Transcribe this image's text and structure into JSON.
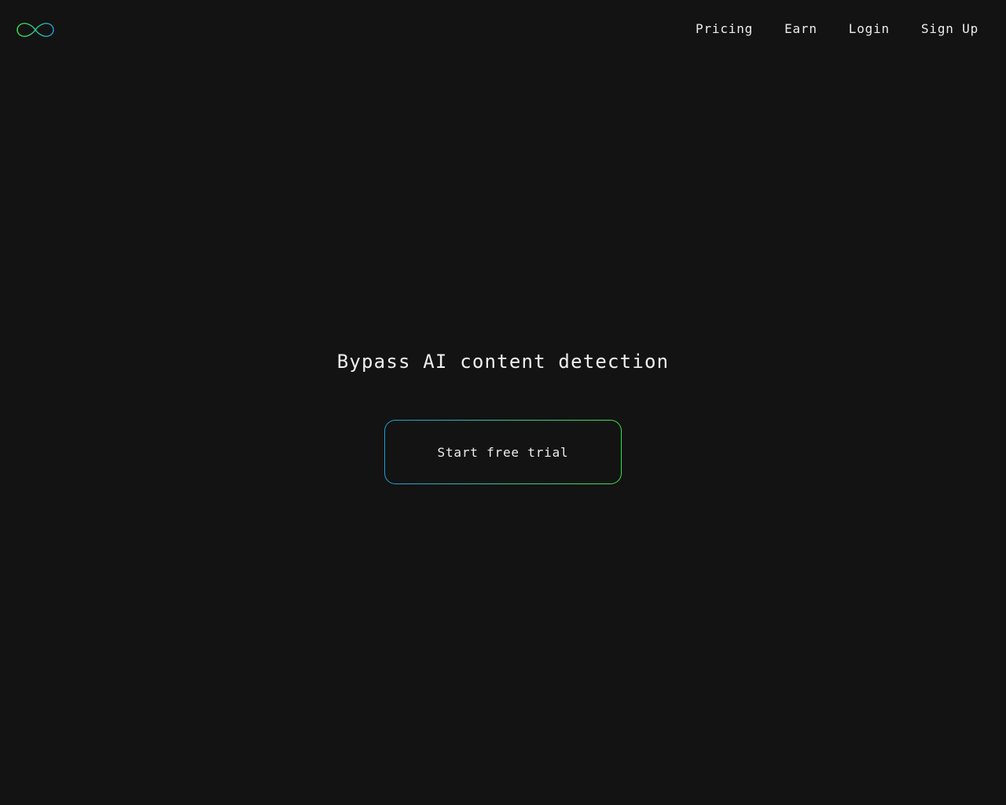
{
  "header": {
    "logo_icon": "infinity-icon",
    "nav": [
      {
        "label": "Pricing"
      },
      {
        "label": "Earn"
      },
      {
        "label": "Login"
      },
      {
        "label": "Sign Up"
      }
    ]
  },
  "hero": {
    "title": "Bypass AI content detection",
    "cta_label": "Start free trial"
  },
  "colors": {
    "background": "#131313",
    "text": "#ededed",
    "gradient_start": "#1e9fd6",
    "gradient_end": "#3be24a"
  }
}
